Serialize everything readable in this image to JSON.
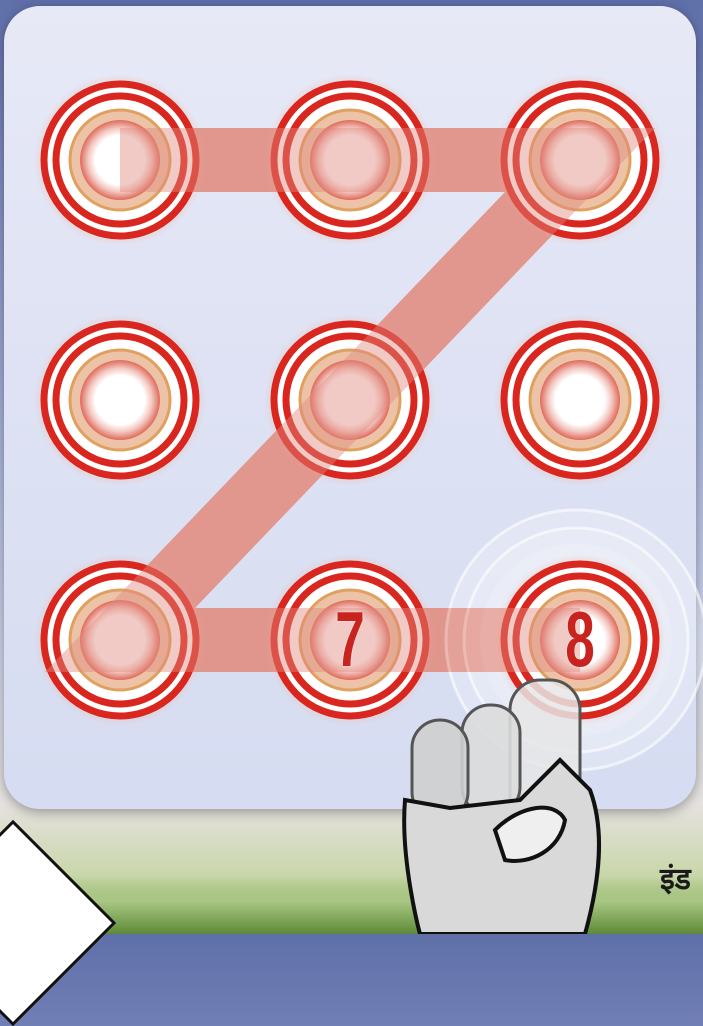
{
  "screen": {
    "title": "",
    "pattern_sequence": [
      3,
      2,
      1,
      5,
      7,
      8,
      9
    ]
  },
  "dots": [
    {
      "id": 1,
      "label": ""
    },
    {
      "id": 2,
      "label": ""
    },
    {
      "id": 3,
      "label": ""
    },
    {
      "id": 4,
      "label": ""
    },
    {
      "id": 5,
      "label": ""
    },
    {
      "id": 6,
      "label": ""
    },
    {
      "id": 7,
      "label": ""
    },
    {
      "id": 8,
      "label": "7"
    },
    {
      "id": 9,
      "label": "8"
    }
  ],
  "caption": {
    "text": "इंड"
  },
  "colors": {
    "ring_red": "#d9261e",
    "connector": "#e39a8f",
    "dot_white": "#ffffff",
    "panel_bg": "#e2e6f5"
  },
  "icons": {
    "gesture": "hand-pointer-icon",
    "tap": "tap-ripple-icon",
    "corner": "corner-arrow-icon"
  }
}
